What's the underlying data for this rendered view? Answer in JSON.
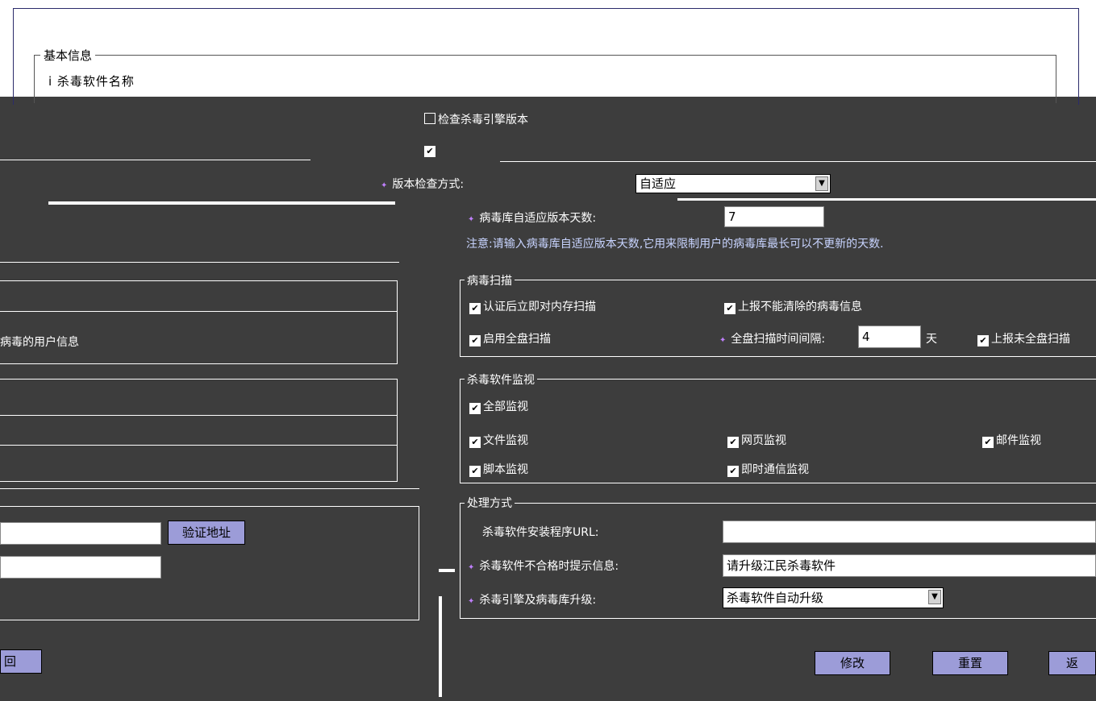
{
  "basic_info": {
    "legend": "基本信息",
    "top_row_text": "i  杀毒软件名称"
  },
  "engine_monitor": {
    "label": "检查杀毒引擎版本",
    "checked": false
  },
  "version_check": {
    "label": "版本检查方式:",
    "value": "自适应"
  },
  "virus_db": {
    "label": "病毒库自适应版本天数:",
    "value": "7",
    "note": "注意:请输入病毒库自适应版本天数,它用来限制用户的病毒库最长可以不更新的天数."
  },
  "left_text": "病毒的用户信息",
  "virus_scan": {
    "legend": "病毒扫描",
    "scan_after_auth": "认证后立即对内存扫描",
    "report_uncleared": "上报不能清除的病毒信息",
    "enable_full_scan": "启用全盘扫描",
    "full_scan_interval_label": "全盘扫描时间间隔:",
    "full_scan_interval_value": "4",
    "days_unit": "天",
    "report_full_scan": "上报未全盘扫描"
  },
  "monitor": {
    "legend": "杀毒软件监视",
    "all": "全部监视",
    "file": "文件监视",
    "web": "网页监视",
    "mail": "邮件监视",
    "script": "脚本监视",
    "im": "即时通信监视"
  },
  "handling": {
    "legend": "处理方式",
    "install_url_label": "杀毒软件安装程序URL:",
    "install_url_value": "",
    "fail_msg_label": "杀毒软件不合格时提示信息:",
    "fail_msg_value": "请升级江民杀毒软件",
    "upgrade_label": "杀毒引擎及病毒库升级:",
    "upgrade_value": "杀毒软件自动升级"
  },
  "left_buttons": {
    "verify": "验证地址",
    "back": "回"
  },
  "buttons": {
    "modify": "修改",
    "reset": "重置",
    "back": "返"
  }
}
